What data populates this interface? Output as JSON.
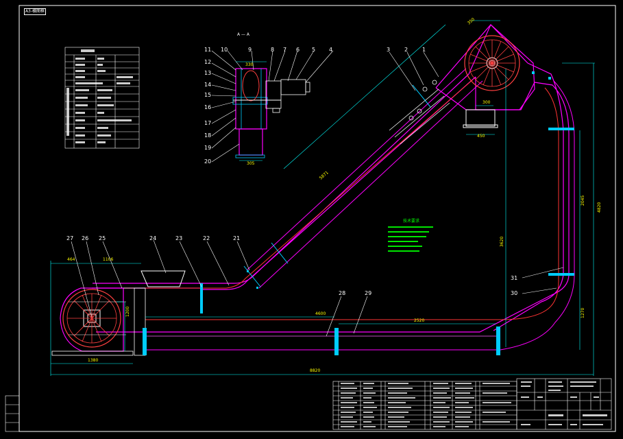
{
  "sheet_tag": "A3-横图框",
  "section_label": "A — A",
  "notes_title": "技术要求",
  "callouts": {
    "n1": "1",
    "n2": "2",
    "n3": "3",
    "n4": "4",
    "n5": "5",
    "n6": "6",
    "n7": "7",
    "n8": "8",
    "n9": "9",
    "n10": "10",
    "n11": "11",
    "n12": "12",
    "n13": "13",
    "n14": "14",
    "n15": "15",
    "n16": "16",
    "n17": "17",
    "n18": "18",
    "n19": "19",
    "n20": "20",
    "n21": "21",
    "n22": "22",
    "n23": "23",
    "n24": "24",
    "n25": "25",
    "n26": "26",
    "n27": "27",
    "n28": "28",
    "n29": "29",
    "n30": "30",
    "n31": "31"
  },
  "dimensions": {
    "overall_length": "8820",
    "lower_span": "4600",
    "upper_span": "2520",
    "left_width": "1380",
    "head_width": "1106",
    "left_height": "1200",
    "right_height": "4820",
    "right_lower": "1270",
    "right_upper": "2045",
    "incline_length": "5871",
    "mid_height": "3620",
    "outlet_width": "450",
    "left_top": "464",
    "hopper_width": "300",
    "head_dim": "350",
    "motor_top": "330",
    "base_width": "305"
  },
  "colors": {
    "background": "#000000",
    "frame": "#ffffff",
    "conveyor_outer": "#ff00ff",
    "conveyor_inner": "#ff3333",
    "dimension": "#00ffff",
    "note_text": "#00ff00",
    "flange": "#00ccff",
    "wheel": "#ff4040"
  }
}
